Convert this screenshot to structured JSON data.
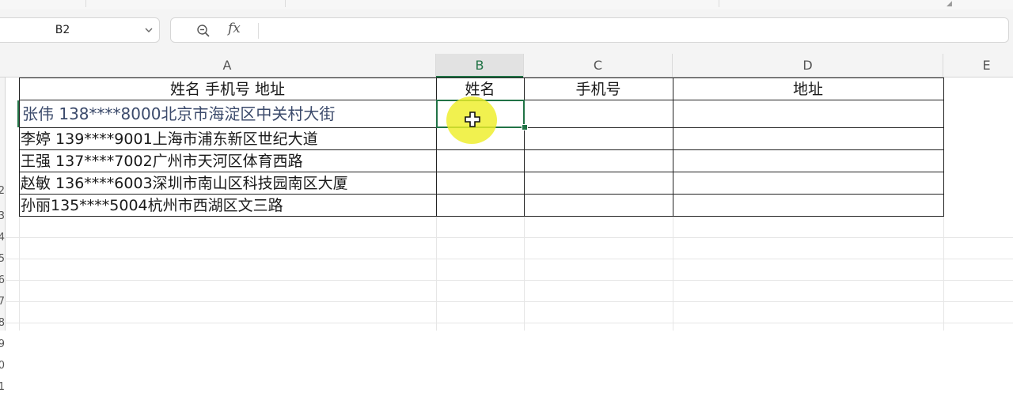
{
  "name_box": {
    "value": "B2"
  },
  "formula_bar": {
    "formula": ""
  },
  "icons": {
    "zoom": "zoom-formula-icon",
    "fx": "fx-icon",
    "chevron": "chevron-down-icon",
    "cursor": "cell-cross-cursor-icon"
  },
  "fx_label": "fx",
  "columns": [
    {
      "id": "A",
      "label": "A"
    },
    {
      "id": "B",
      "label": "B",
      "active": true
    },
    {
      "id": "C",
      "label": "C"
    },
    {
      "id": "D",
      "label": "D"
    },
    {
      "id": "E",
      "label": "E"
    }
  ],
  "row_numbers": [
    "2",
    "3",
    "4",
    "5",
    "6",
    "7",
    "8",
    "9",
    "0",
    "1"
  ],
  "header_row": {
    "a": "姓名  手机号  地址",
    "b": "姓名",
    "c": "手机号",
    "d": "地址"
  },
  "rows": [
    {
      "a": "张伟 138****8000北京市海淀区中关村大街"
    },
    {
      "a": "李婷  139****9001上海市浦东新区世纪大道"
    },
    {
      "a": "王强  137****7002广州市天河区体育西路"
    },
    {
      "a": "赵敏  136****6003深圳市南山区科技园南区大厦"
    },
    {
      "a": "孙丽135****5004杭州市西湖区文三路"
    }
  ],
  "selected_cell": "B2",
  "colors": {
    "accent": "#217346",
    "highlight": "#eeee28"
  }
}
